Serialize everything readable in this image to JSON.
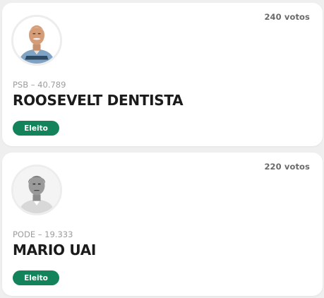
{
  "candidates": [
    {
      "votes": "240 votos",
      "party_line": "PSB – 40.789",
      "name": "ROOSEVELT DENTISTA",
      "status": "Eleito",
      "status_color": "#13835b"
    },
    {
      "votes": "220 votos",
      "party_line": "PODE – 19.333",
      "name": "MARIO UAI",
      "status": "Eleito",
      "status_color": "#13835b"
    }
  ]
}
